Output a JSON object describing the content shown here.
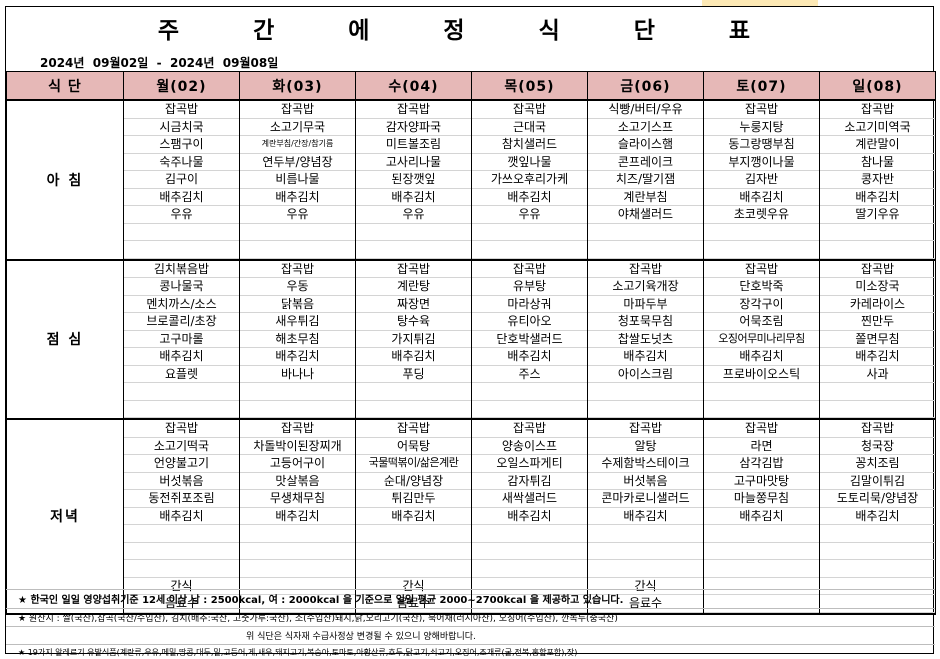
{
  "title": "주 간 에 정 식 단 표",
  "date_range": "2024년  09월02일  -  2024년  09월08일",
  "header": {
    "meal_label": "식 단",
    "days": [
      "월(02)",
      "화(03)",
      "수(04)",
      "목(05)",
      "금(06)",
      "토(07)",
      "일(08)"
    ]
  },
  "meals": [
    {
      "name": "아 침",
      "days": [
        [
          "잡곡밥",
          "시금치국",
          "스팸구이",
          "숙주나물",
          "김구이",
          "배추김치",
          "우유"
        ],
        [
          "잡곡밥",
          "소고기무국",
          "계란부침/간장/참기름",
          "연두부/양념장",
          "비름나물",
          "배추김치",
          "우유"
        ],
        [
          "잡곡밥",
          "감자양파국",
          "미트볼조림",
          "고사리나물",
          "된장깻잎",
          "배추김치",
          "우유"
        ],
        [
          "잡곡밥",
          "근대국",
          "참치샐러드",
          "깻잎나물",
          "가쓰오후리가케",
          "배추김치",
          "우유"
        ],
        [
          "식빵/버터/우유",
          "소고기스프",
          "슬라이스햄",
          "콘프레이크",
          "치즈/딸기잼",
          "계란부침",
          "야채샐러드"
        ],
        [
          "잡곡밥",
          "누룽지탕",
          "동그랑땡부침",
          "부지깽이나물",
          "김자반",
          "배추김치",
          "초코렛우유"
        ],
        [
          "잡곡밥",
          "소고기미역국",
          "계란말이",
          "참나물",
          "콩자반",
          "배추김치",
          "딸기우유"
        ]
      ]
    },
    {
      "name": "점 심",
      "days": [
        [
          "김치볶음밥",
          "콩나물국",
          "멘치까스/소스",
          "브로콜리/초장",
          "고구마롤",
          "배추김치",
          "요플렛"
        ],
        [
          "잡곡밥",
          "우동",
          "닭볶음",
          "새우튀김",
          "해초무침",
          "배추김치",
          "바나나"
        ],
        [
          "잡곡밥",
          "계란탕",
          "짜장면",
          "탕수육",
          "가지튀김",
          "배추김치",
          "푸딩"
        ],
        [
          "잡곡밥",
          "유부탕",
          "마라상궈",
          "유티아오",
          "단호박샐러드",
          "배추김치",
          "주스"
        ],
        [
          "잡곡밥",
          "소고기육개장",
          "마파두부",
          "청포묵무침",
          "찹쌀도넛츠",
          "배추김치",
          "아이스크림"
        ],
        [
          "잡곡밥",
          "단호박죽",
          "장각구이",
          "어묵조림",
          "오징어무미나리무침",
          "배추김치",
          "프로바이오스틱"
        ],
        [
          "잡곡밥",
          "미소장국",
          "카레라이스",
          "찐만두",
          "쫄면무침",
          "배추김치",
          "사과"
        ]
      ]
    },
    {
      "name": "저녁",
      "days": [
        [
          "잡곡밥",
          "소고기떡국",
          "언양불고기",
          "버섯볶음",
          "동전쥐포조림",
          "배추김치",
          "",
          "",
          "",
          "간식",
          "음료수"
        ],
        [
          "잡곡밥",
          "차돌박이된장찌개",
          "고등어구이",
          "맛살볶음",
          "무생채무침",
          "배추김치",
          "",
          "",
          "",
          "",
          ""
        ],
        [
          "잡곡밥",
          "어묵탕",
          "국물떡볶이/삶은계란",
          "순대/양념장",
          "튀김만두",
          "배추김치",
          "",
          "",
          "",
          "간식",
          "음료수"
        ],
        [
          "잡곡밥",
          "양송이스프",
          "오일스파게티",
          "감자튀김",
          "새싹샐러드",
          "배추김치",
          "",
          "",
          "",
          "",
          ""
        ],
        [
          "잡곡밥",
          "알탕",
          "수제함박스테이크",
          "버섯볶음",
          "콘마카로니샐러드",
          "배추김치",
          "",
          "",
          "",
          "간식",
          "음료수"
        ],
        [
          "잡곡밥",
          "라면",
          "삼각김밥",
          "고구마맛탕",
          "마늘쫑무침",
          "배추김치",
          "",
          "",
          "",
          "",
          ""
        ],
        [
          "잡곡밥",
          "청국장",
          "꽁치조림",
          "김말이튀김",
          "도토리묵/양념장",
          "배추김치",
          "",
          "",
          "",
          "",
          ""
        ]
      ]
    }
  ],
  "notes": [
    "★ 한국인 일일 영양섭취기준 12세 이상 남 : 2500kcal, 여 : 2000kcal 을 기준으로 일일 평균 2000~2700kcal 을 제공하고 있습니다.",
    "★ 원산지 : 쌀(국산),잡곡(국산/수입산), 김치(배추:국산, 고춧가루:국산), 소(수입산)돼지,닭,오리고기(국산), 북어채(러시아산), 오징어(수입산), 깐녹두(중국산)",
    "위 식단은 식자재 수급사정상 변경될 수 있으니 양해바랍니다.",
    "★ 19가지 알레르기 유발식품(계란류,우유,메밀,땅콩,대두,밀,고등어,게,새우,돼지고기,복숭아,토마토,아황산류,호두,닭고기,쇠고기,오징어,조개류(굴,전복,홍합포함),잣)"
  ]
}
